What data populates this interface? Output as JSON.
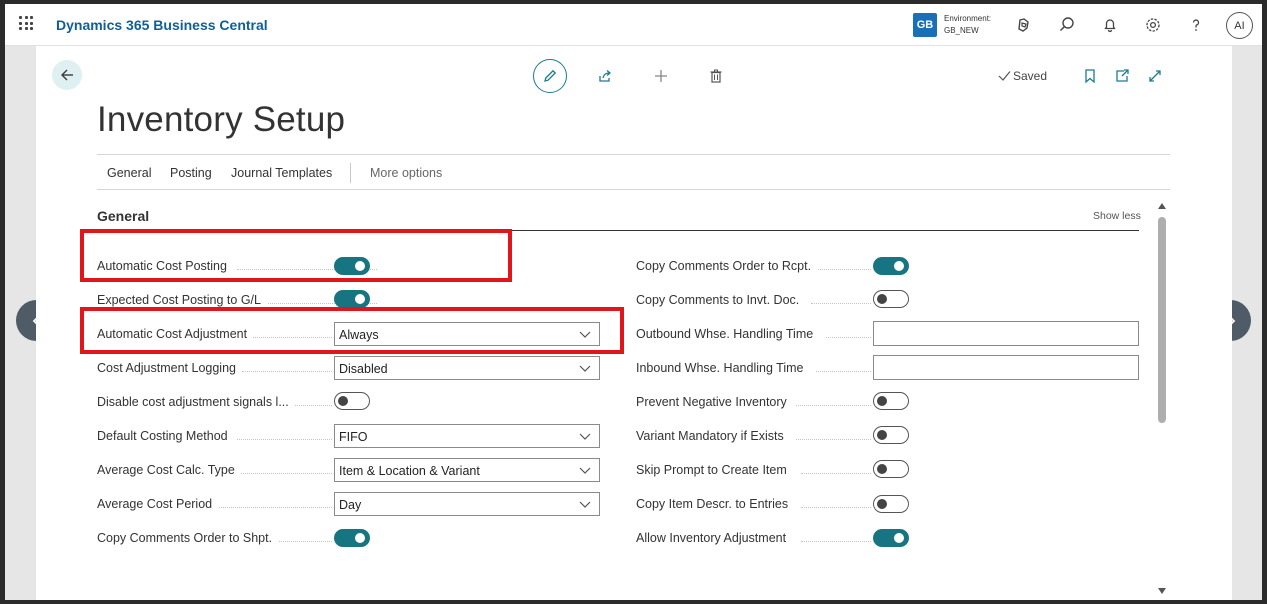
{
  "app": {
    "brand": "Dynamics 365 Business Central",
    "environment_badge": "GB",
    "environment_label": "Environment:",
    "environment_name": "GB_NEW",
    "avatar_initials": "AI"
  },
  "page": {
    "title": "Inventory Setup",
    "saved_label": "Saved",
    "tabs": [
      "General",
      "Posting",
      "Journal Templates"
    ],
    "more_options": "More options",
    "section_title": "General",
    "show_less": "Show less"
  },
  "left_fields": [
    {
      "label": "Automatic Cost Posting",
      "type": "toggle",
      "value": true
    },
    {
      "label": "Expected Cost Posting to G/L",
      "type": "toggle",
      "value": true
    },
    {
      "label": "Automatic Cost Adjustment",
      "type": "select",
      "value": "Always"
    },
    {
      "label": "Cost Adjustment Logging",
      "type": "select",
      "value": "Disabled"
    },
    {
      "label": "Disable cost adjustment signals l...",
      "type": "toggle",
      "value": false
    },
    {
      "label": "Default Costing Method",
      "type": "select",
      "value": "FIFO"
    },
    {
      "label": "Average Cost Calc. Type",
      "type": "select",
      "value": "Item & Location & Variant"
    },
    {
      "label": "Average Cost Period",
      "type": "select",
      "value": "Day"
    },
    {
      "label": "Copy Comments Order to Shpt.",
      "type": "toggle",
      "value": true
    }
  ],
  "right_fields": [
    {
      "label": "Copy Comments Order to Rcpt.",
      "type": "toggle",
      "value": true
    },
    {
      "label": "Copy Comments to Invt. Doc.",
      "type": "toggle",
      "value": false
    },
    {
      "label": "Outbound Whse. Handling Time",
      "type": "text",
      "value": ""
    },
    {
      "label": "Inbound Whse. Handling Time",
      "type": "text",
      "value": ""
    },
    {
      "label": "Prevent Negative Inventory",
      "type": "toggle",
      "value": false
    },
    {
      "label": "Variant Mandatory if Exists",
      "type": "toggle",
      "value": false
    },
    {
      "label": "Skip Prompt to Create Item",
      "type": "toggle",
      "value": false
    },
    {
      "label": "Copy Item Descr. to Entries",
      "type": "toggle",
      "value": false
    },
    {
      "label": "Allow Inventory Adjustment",
      "type": "toggle",
      "value": true
    }
  ],
  "colors": {
    "accent": "#177582",
    "brand": "#0f5f97",
    "highlight": "#e0161b"
  }
}
